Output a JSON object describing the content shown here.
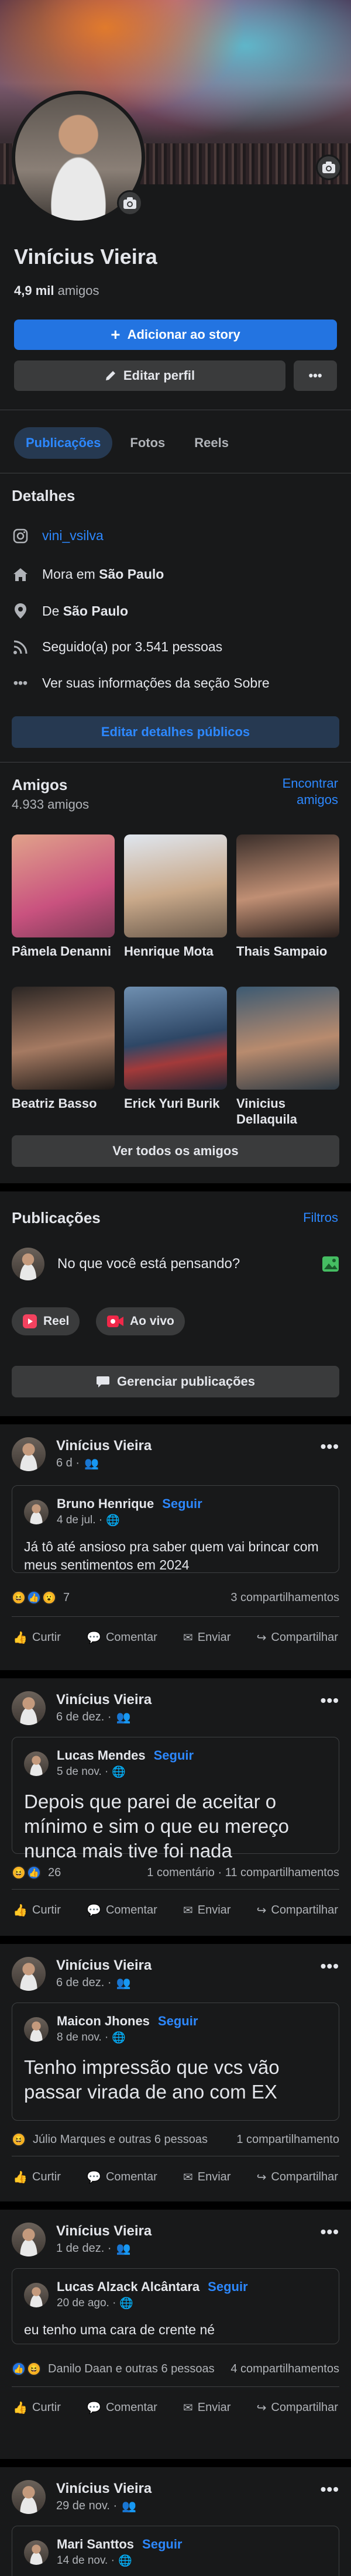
{
  "profile": {
    "name": "Vinícius Vieira",
    "friends_number": "4,9 mil",
    "friends_word": "amigos",
    "add_story": "Adicionar ao story",
    "edit_profile": "Editar perfil",
    "more": "•••"
  },
  "tabs": [
    "Publicações",
    "Fotos",
    "Reels"
  ],
  "details": {
    "title": "Detalhes",
    "instagram": "vini_vsilva",
    "lives_prefix": "Mora em",
    "lives_city": "São Paulo",
    "from_prefix": "De",
    "from_city": "São Paulo",
    "followers": "Seguido(a) por 3.541 pessoas",
    "see_about": "Ver suas informações da seção Sobre",
    "edit_public": "Editar detalhes públicos"
  },
  "friends": {
    "title": "Amigos",
    "count": "4.933 amigos",
    "find_line1": "Encontrar",
    "find_line2": "amigos",
    "list": [
      "Pâmela Denanni",
      "Henrique Mota",
      "Thais Sampaio",
      "Beatriz Basso",
      "Erick Yuri Burik",
      "Vinicius Dellaquila"
    ],
    "see_all": "Ver todos os amigos"
  },
  "publications": {
    "title": "Publicações",
    "filters": "Filtros",
    "composer": "No que você está pensando?",
    "reel": "Reel",
    "live": "Ao vivo",
    "manage": "Gerenciar publicações"
  },
  "actions": {
    "like": "Curtir",
    "comment": "Comentar",
    "send": "Enviar",
    "share": "Compartilhar"
  },
  "posts": [
    {
      "author": "Vinícius Vieira",
      "time": "6 d ·",
      "shared_author": "Bruno Henrique",
      "follow": "Seguir",
      "shared_time": "4 de jul. ·",
      "text": "Já tô até ansioso pra saber quem vai brincar com meus sentimentos em 2024",
      "reactions": "7",
      "comments": "",
      "shares": "3 compartilhamentos"
    },
    {
      "author": "Vinícius Vieira",
      "time": "6 de dez. ·",
      "shared_author": "Lucas Mendes",
      "follow": "Seguir",
      "shared_time": "5 de nov. ·",
      "text": "Depois que parei de aceitar o mínimo e sim o que eu mereço nunca mais tive foi nada",
      "reactions": "26",
      "comments": "1 comentário",
      "shares": "11 compartilhamentos"
    },
    {
      "author": "Vinícius Vieira",
      "time": "6 de dez. ·",
      "shared_author": "Maicon Jhones",
      "follow": "Seguir",
      "shared_time": "8 de nov. ·",
      "text": "Tenho impressão que vcs vão passar virada de ano com EX",
      "reactions": "Júlio Marques e outras 6 pessoas",
      "comments": "",
      "shares": "1 compartilhamento"
    },
    {
      "author": "Vinícius Vieira",
      "time": "1 de dez. ·",
      "shared_author": "Lucas Alzack Alcântara",
      "follow": "Seguir",
      "shared_time": "20 de ago. ·",
      "text": "eu tenho uma cara de crente né",
      "reactions": "Danilo Daan e outras 6 pessoas",
      "comments": "",
      "shares": "4 compartilhamentos"
    },
    {
      "author": "Vinícius Vieira",
      "time": "29 de nov. ·",
      "shared_author": "Mari Santtos",
      "follow": "Seguir",
      "shared_time": "14 de nov. ·",
      "text": "",
      "reactions": "",
      "comments": "",
      "shares": ""
    }
  ],
  "colors": {
    "bg": "#18191a",
    "accent": "#2374e1",
    "link": "#2d88ff",
    "button": "#3a3b3c"
  }
}
